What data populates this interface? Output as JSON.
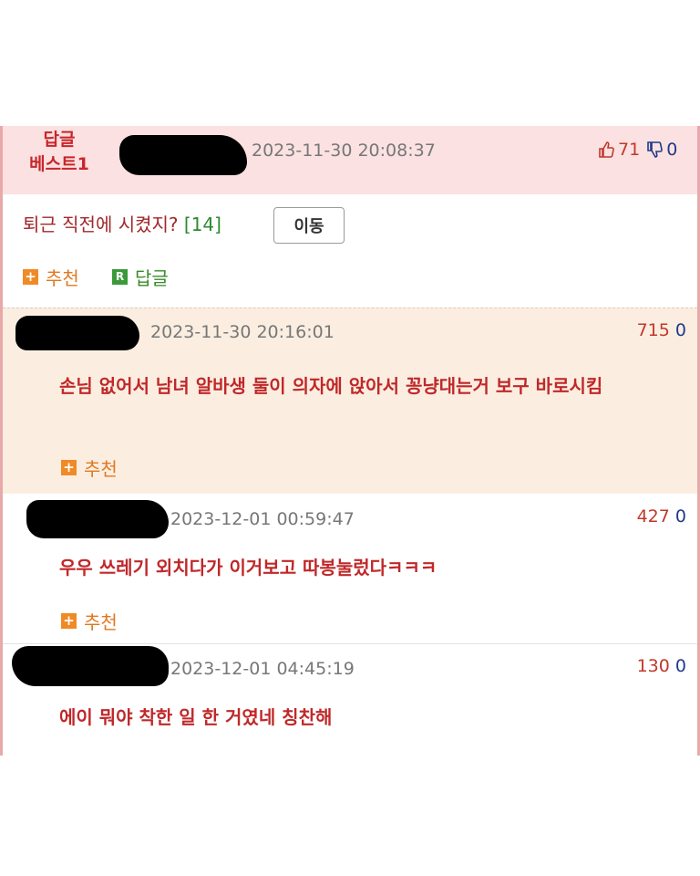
{
  "best": {
    "label_line1": "답글",
    "label_line2": "베스트1",
    "date": "2023-11-30 20:08:37",
    "up_count": "71",
    "down_count": "0",
    "title": "퇴근 직전에 시켰지?",
    "reply_count": "[14]",
    "move_label": "이동",
    "recommend_label": "추천",
    "reply_label": "답글"
  },
  "comments": [
    {
      "date": "2023-11-30 20:16:01",
      "up": "715",
      "down": "0",
      "text": "손님 없어서 남녀 알바생 둘이 의자에 앉아서 꽁냥대는거 보구 바로시킴",
      "recommend_label": "추천"
    },
    {
      "date": "2023-12-01 00:59:47",
      "up": "427",
      "down": "0",
      "text": "우우 쓰레기 외치다가 이거보고 따봉눌렀다ㅋㅋㅋ",
      "recommend_label": "추천"
    },
    {
      "date": "2023-12-01 04:45:19",
      "up": "130",
      "down": "0",
      "text": "에이 뭐야 착한 일 한 거였네 칭찬해"
    }
  ],
  "colors": {
    "best_bg": "#fbe1e1",
    "highlight_bg": "#fbeee1",
    "comment_text": "#c0282a",
    "border_pink": "#e8a9ab"
  },
  "icons": [
    "thumbs-up-icon",
    "thumbs-down-icon",
    "plus-square-icon",
    "reply-r-icon"
  ]
}
